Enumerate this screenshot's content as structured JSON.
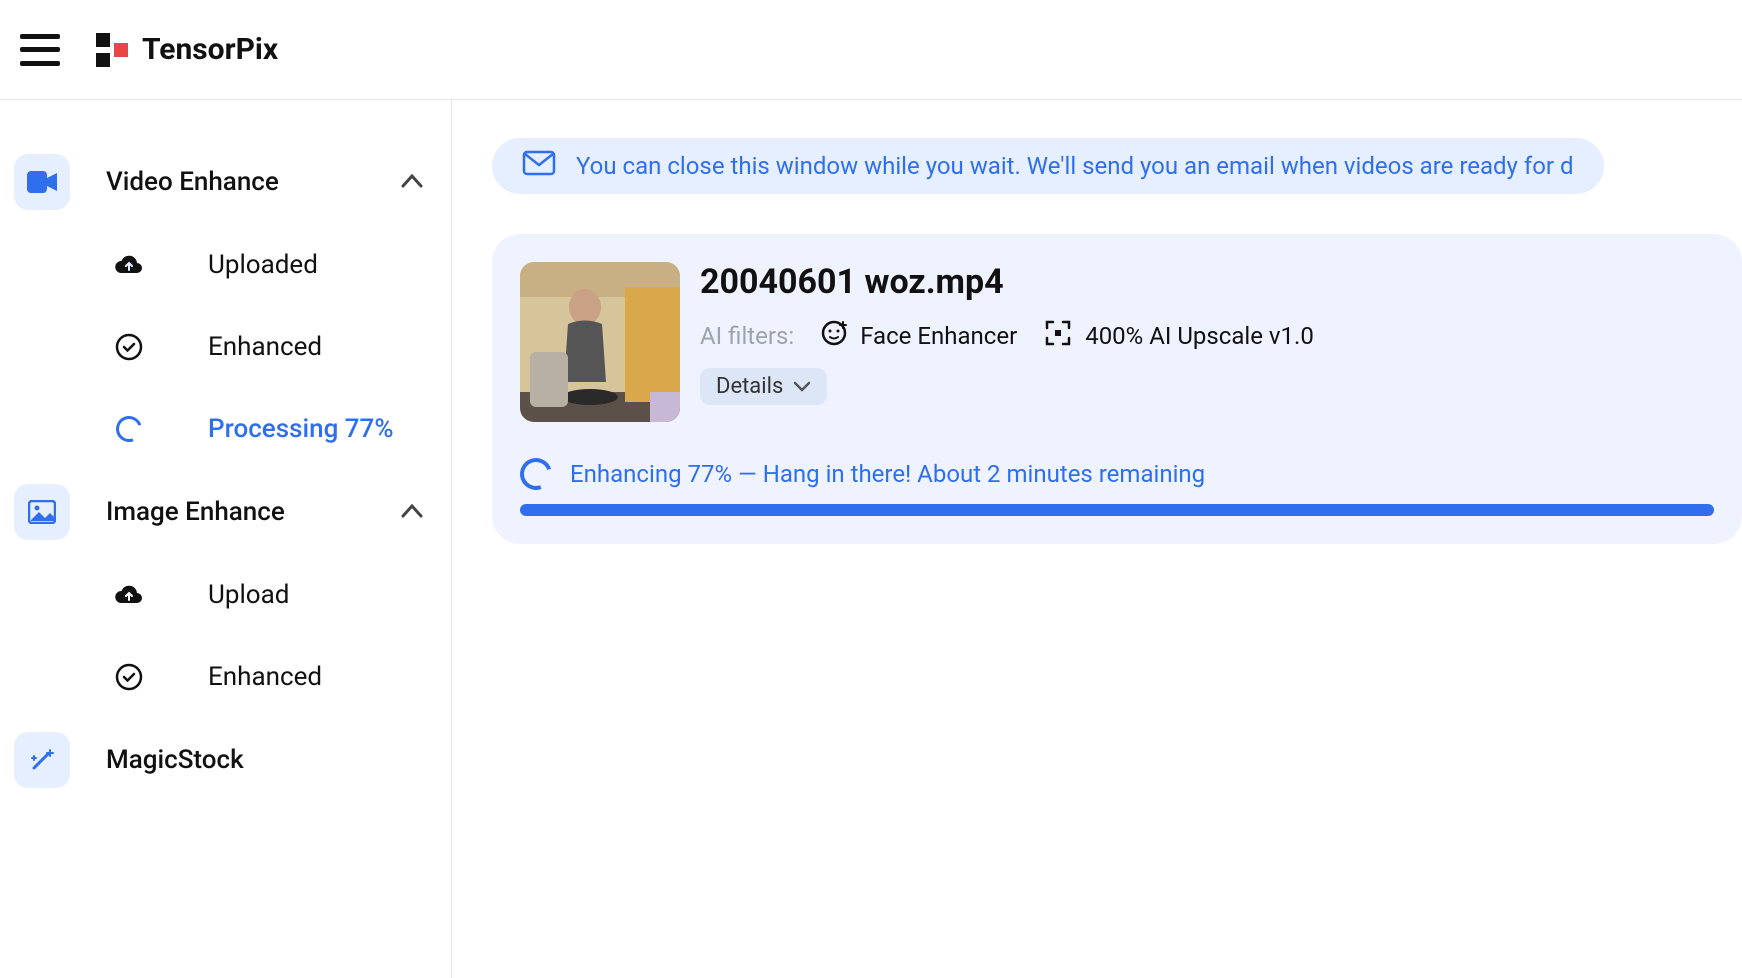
{
  "app": {
    "name": "TensorPix"
  },
  "sidebar": {
    "video": {
      "label": "Video Enhance",
      "uploaded": "Uploaded",
      "enhanced": "Enhanced",
      "processing": "Processing 77%"
    },
    "image": {
      "label": "Image Enhance",
      "upload": "Upload",
      "enhanced": "Enhanced"
    },
    "magicstock": "MagicStock"
  },
  "banner": {
    "text": "You can close this window while you wait. We'll send you an email when videos are ready for d"
  },
  "job": {
    "title": "20040601 woz.mp4",
    "filters_label": "AI filters:",
    "filter_face": "Face Enhancer",
    "filter_upscale": "400% AI Upscale v1.0",
    "details_label": "Details",
    "progress_text": "Enhancing 77% — Hang in there! About 2 minutes remaining",
    "progress_pct": 77
  }
}
